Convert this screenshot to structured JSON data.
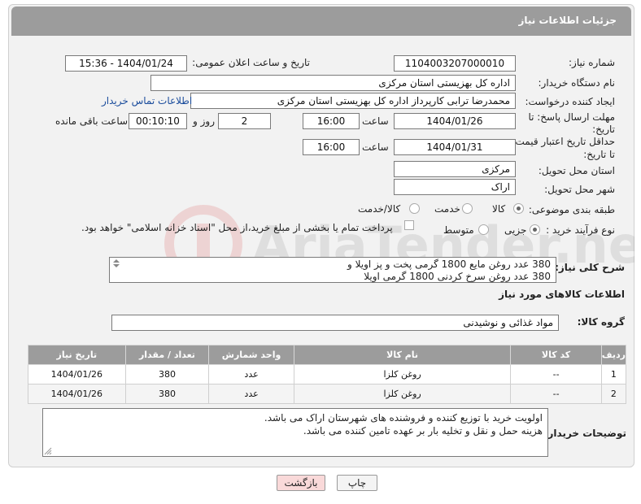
{
  "header": {
    "title": "جزئیات اطلاعات نیاز"
  },
  "need_number": {
    "label": "شماره نیاز:",
    "value": "1104003207000010"
  },
  "announce": {
    "label": "تاریخ و ساعت اعلان عمومی:",
    "value": "1404/01/24 - 15:36"
  },
  "buyer_org": {
    "label": "نام دستگاه خریدار:",
    "value": "اداره کل بهزیستی استان مرکزی"
  },
  "requester": {
    "label": "ایجاد کننده درخواست:",
    "value": "محمدرضا ترابی کارپرداز اداره کل بهزیستی استان مرکزی",
    "contact_link": "اطلاعات تماس خریدار"
  },
  "reply_deadline": {
    "label_line1": "مهلت ارسال پاسخ: تا",
    "label_line2": "تاریخ:",
    "date": "1404/01/26",
    "time_label": "ساعت",
    "time": "16:00",
    "days": "2",
    "days_label": "روز و",
    "remaining": "00:10:10",
    "remaining_label": "ساعت باقی مانده"
  },
  "price_deadline": {
    "label_line1": "حداقل تاریخ اعتبار قیمت:",
    "label_line2": "تا تاریخ:",
    "date": "1404/01/31",
    "time_label": "ساعت",
    "time": "16:00"
  },
  "province": {
    "label": "استان محل تحویل:",
    "value": "مرکزی"
  },
  "city": {
    "label": "شهر محل تحویل:",
    "value": "اراک"
  },
  "category": {
    "label": "طبقه بندی موضوعی:",
    "options": [
      "کالا",
      "خدمت",
      "کالا/خدمت"
    ],
    "selected": "کالا"
  },
  "process": {
    "label": "نوع فرآیند خرید :",
    "options": [
      "جزیی",
      "متوسط"
    ],
    "selected": "جزیی",
    "payment_note": "پرداخت تمام یا بخشی از مبلغ خرید،از محل \"اسناد خزانه اسلامی\" خواهد بود."
  },
  "description": {
    "label": "شرح کلی نیاز:",
    "line1": "380 عدد روغن مایع 1800 گرمی پخت و پز اویلا و",
    "line2": "380 عدد روغن سرخ کردنی 1800 گرمی اویلا"
  },
  "goods_section": {
    "title": "اطلاعات کالاهای مورد نیاز"
  },
  "goods_group": {
    "label": "گروه کالا:",
    "value": "مواد غذائی و نوشیدنی"
  },
  "table": {
    "headers": [
      "ردیف",
      "کد کالا",
      "نام کالا",
      "واحد شمارش",
      "تعداد / مقدار",
      "تاریخ نیاز"
    ],
    "rows": [
      [
        "1",
        "--",
        "روغن کلزا",
        "عدد",
        "380",
        "1404/01/26"
      ],
      [
        "2",
        "--",
        "روغن کلزا",
        "عدد",
        "380",
        "1404/01/26"
      ]
    ]
  },
  "buyer_notes": {
    "label": "توضیحات خریدار:",
    "line1": "اولویت خرید با توزیع کننده و فروشنده های شهرستان اراک می باشد.",
    "line2": "هزینه حمل و نقل و تخلیه بار بر عهده تامین کننده می باشد."
  },
  "buttons": {
    "print": "چاپ",
    "back": "بازگشت"
  },
  "watermark": {
    "text": "AriaTender.neT"
  },
  "colors": {
    "header_bg": "#9c9c9c",
    "link": "#1a4c9c",
    "back_button_bg": "#f9d9d9"
  }
}
